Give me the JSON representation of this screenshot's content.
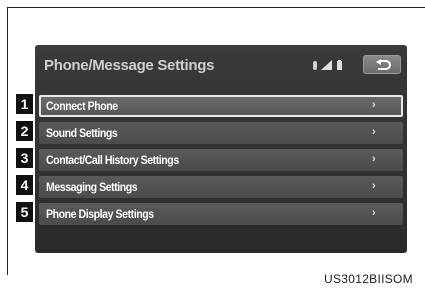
{
  "screen": {
    "title": "Phone/Message Settings",
    "status_icons": [
      "bluetooth-icon",
      "signal-strength-icon",
      "battery-icon"
    ],
    "back_button_icon": "back-arrow-icon"
  },
  "menu": {
    "items": [
      {
        "label": "Connect Phone",
        "selected": true,
        "chevron": "›"
      },
      {
        "label": "Sound Settings",
        "selected": false,
        "chevron": "›"
      },
      {
        "label": "Contact/Call History Settings",
        "selected": false,
        "chevron": "›"
      },
      {
        "label": "Messaging Settings",
        "selected": false,
        "chevron": "›"
      },
      {
        "label": "Phone Display Settings",
        "selected": false,
        "chevron": "›"
      }
    ]
  },
  "callouts": [
    "1",
    "2",
    "3",
    "4",
    "5"
  ],
  "figure_code": "US3012BIISOM"
}
